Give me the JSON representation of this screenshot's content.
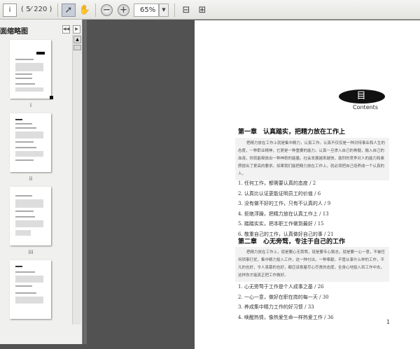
{
  "toolbar": {
    "page_input": "i",
    "page_count": "( 5⁄ 220 )",
    "zoom": "65%"
  },
  "sidebar": {
    "title": "面缩略图",
    "thumb_labels": [
      "i",
      "ii",
      "iii"
    ]
  },
  "document": {
    "logo_text": "目录",
    "contents_label": "Contents",
    "chapter1": {
      "title": "第一章　认真踏实，把精力放在工作上",
      "intro": "把精力放在工作上就是集中精力，认真工作。认真不仅仅是一种对待事业和人生的态度，一种职业精神，它更是一种重要的能力。认真一旦渗入自己的骨髓，融入自己的血液，你就能释放出一种神奇的能量。社会发展越来越快，激烈的竞争对人的能力和素质提出了更高的要求。如果我们能把精力放在工作上，就必须把自己培养成一个认真的人。",
      "items": [
        "1. 任何工作，都需要认真的态度 / 2",
        "2. 认真比认证更能证明员工的价值 / 6",
        "3. 没有做不好的工作，只有不认真的人 / 9",
        "4. 拒绝浮躁，把精力放在认真工作上 / 13",
        "5. 踏踏实实，把本职工作做到最好 / 15",
        "6. 敬重自己的工作，认真做好自己的事 / 21"
      ]
    },
    "chapter2": {
      "title": "第二章　心无旁骛，专注于自己的工作",
      "intro": "把精力放在工作上，就是要心无旁骛，就是要专心致志，就是要一心一意，不被任何琐事打扰，集中精力投入工作，这一种付出，一种奉献。不管从事什么样的工作，平凡的也好，令人羡慕的也好，都应该抱着尽心尽责的态度，全身心地投入到工作中去，这样你才能真正把工作做好。",
      "items": [
        "1. 心无旁骛于工作是个人成事之基 / 26",
        "2. 一心一意，做好在职在岗的每一天 / 30",
        "3. 养成集中精力工作的好习惯 / 33",
        "4. 唤醒热情，像热爱生命一样热爱工作 / 36"
      ]
    },
    "page_number": "1"
  }
}
